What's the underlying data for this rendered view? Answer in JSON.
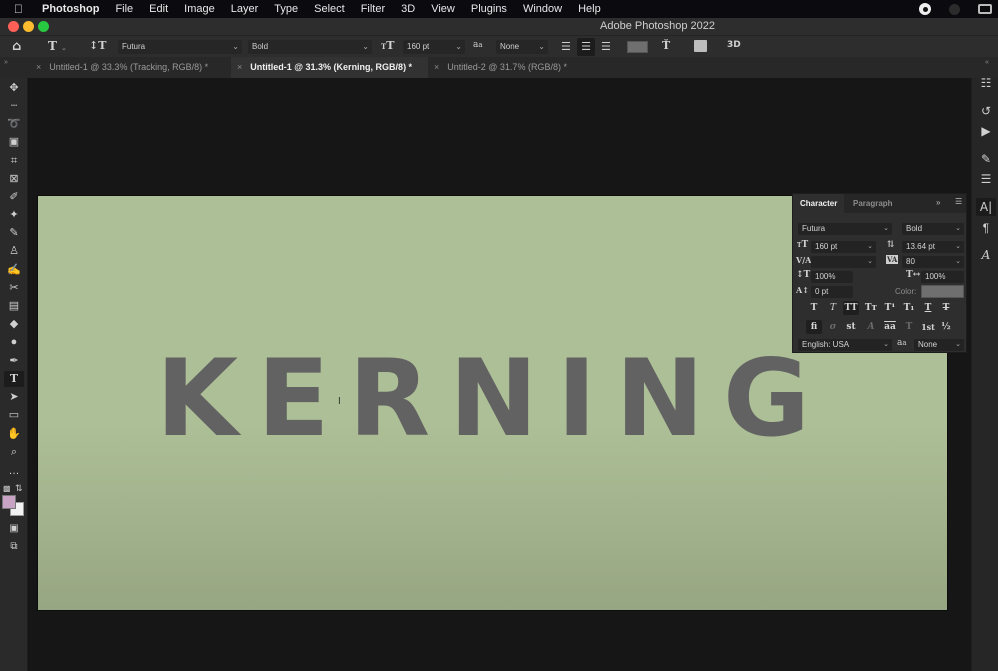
{
  "menubar": {
    "apple_icon": "apple-logo",
    "app_name": "Photoshop",
    "items": [
      "File",
      "Edit",
      "Image",
      "Layer",
      "Type",
      "Select",
      "Filter",
      "3D",
      "View",
      "Plugins",
      "Window",
      "Help"
    ]
  },
  "window": {
    "title": "Adobe Photoshop 2022",
    "traffic_colors": {
      "close": "#fe5f57",
      "minimize": "#febc2e",
      "zoom": "#28c840"
    }
  },
  "options_bar": {
    "home_icon": "home-icon",
    "type_tool_icon": "T",
    "orientation_icon": "↕T",
    "font_family": "Futura",
    "font_style": "Bold",
    "font_size_icon": "T",
    "font_size": "160 pt",
    "antialias_icon": "aₐ",
    "antialias": "None",
    "align": [
      "left",
      "center",
      "right"
    ],
    "align_active": "center",
    "text_color": "#6f6f6f",
    "three_d_label": "3D"
  },
  "tabs": [
    {
      "label": "Untitled-1 @ 33.3% (Tracking, RGB/8) *",
      "active": false
    },
    {
      "label": "Untitled-1 @ 31.3% (Kerning, RGB/8) *",
      "active": true
    },
    {
      "label": "Untitled-2 @ 31.7% (RGB/8) *",
      "active": false
    }
  ],
  "tools": [
    {
      "name": "move-tool",
      "glyph": "✥"
    },
    {
      "name": "marquee-tool",
      "glyph": "┄"
    },
    {
      "name": "lasso-tool",
      "glyph": "➰"
    },
    {
      "name": "object-select-tool",
      "glyph": "▣"
    },
    {
      "name": "crop-tool",
      "glyph": "⌗"
    },
    {
      "name": "frame-tool",
      "glyph": "⊠"
    },
    {
      "name": "eyedropper-tool",
      "glyph": "✐"
    },
    {
      "name": "healing-brush-tool",
      "glyph": "✦"
    },
    {
      "name": "brush-tool",
      "glyph": "✎"
    },
    {
      "name": "clone-stamp-tool",
      "glyph": "♙"
    },
    {
      "name": "history-brush-tool",
      "glyph": "✍"
    },
    {
      "name": "eraser-tool",
      "glyph": "✂"
    },
    {
      "name": "gradient-tool",
      "glyph": "▤"
    },
    {
      "name": "blur-tool",
      "glyph": "◆"
    },
    {
      "name": "dodge-tool",
      "glyph": "●"
    },
    {
      "name": "pen-tool",
      "glyph": "✒"
    },
    {
      "name": "type-tool",
      "glyph": "T"
    },
    {
      "name": "path-select-tool",
      "glyph": "➤"
    },
    {
      "name": "rectangle-tool",
      "glyph": "▭"
    },
    {
      "name": "hand-tool",
      "glyph": "✋"
    },
    {
      "name": "zoom-tool",
      "glyph": "⌕"
    },
    {
      "name": "more-tools",
      "glyph": "…"
    }
  ],
  "active_tool": "type-tool",
  "colors": {
    "foreground": "#c9a3c4",
    "background": "#f2f2f2"
  },
  "canvas": {
    "text": "KERNING",
    "background_color": "#adbf97",
    "text_color": "#626262"
  },
  "character_panel": {
    "tabs": [
      "Character",
      "Paragraph"
    ],
    "active_tab": "Character",
    "font_family": "Futura",
    "font_style": "Bold",
    "font_size": "160 pt",
    "leading": "13.64 pt",
    "kerning": "",
    "tracking": "80",
    "vertical_scale": "100%",
    "horizontal_scale": "100%",
    "baseline_shift": "0 pt",
    "color_label": "Color:",
    "color_value": "#6f6f6f",
    "style_buttons": [
      "T",
      "T",
      "TT",
      "Tᴛ",
      "T¹",
      "T₁",
      "T",
      "T"
    ],
    "opentype_buttons": [
      "fi",
      "σ",
      "st",
      "A",
      "aa",
      "T",
      "1st",
      "½"
    ],
    "language": "English: USA",
    "antialias_icon": "aₐ",
    "antialias": "None"
  },
  "right_dock": [
    "properties-icon",
    "history-icon",
    "play-actions-icon",
    "brush-settings-icon",
    "adjustments-icon",
    "character-icon",
    "paragraph-icon",
    "glyphs-icon"
  ]
}
